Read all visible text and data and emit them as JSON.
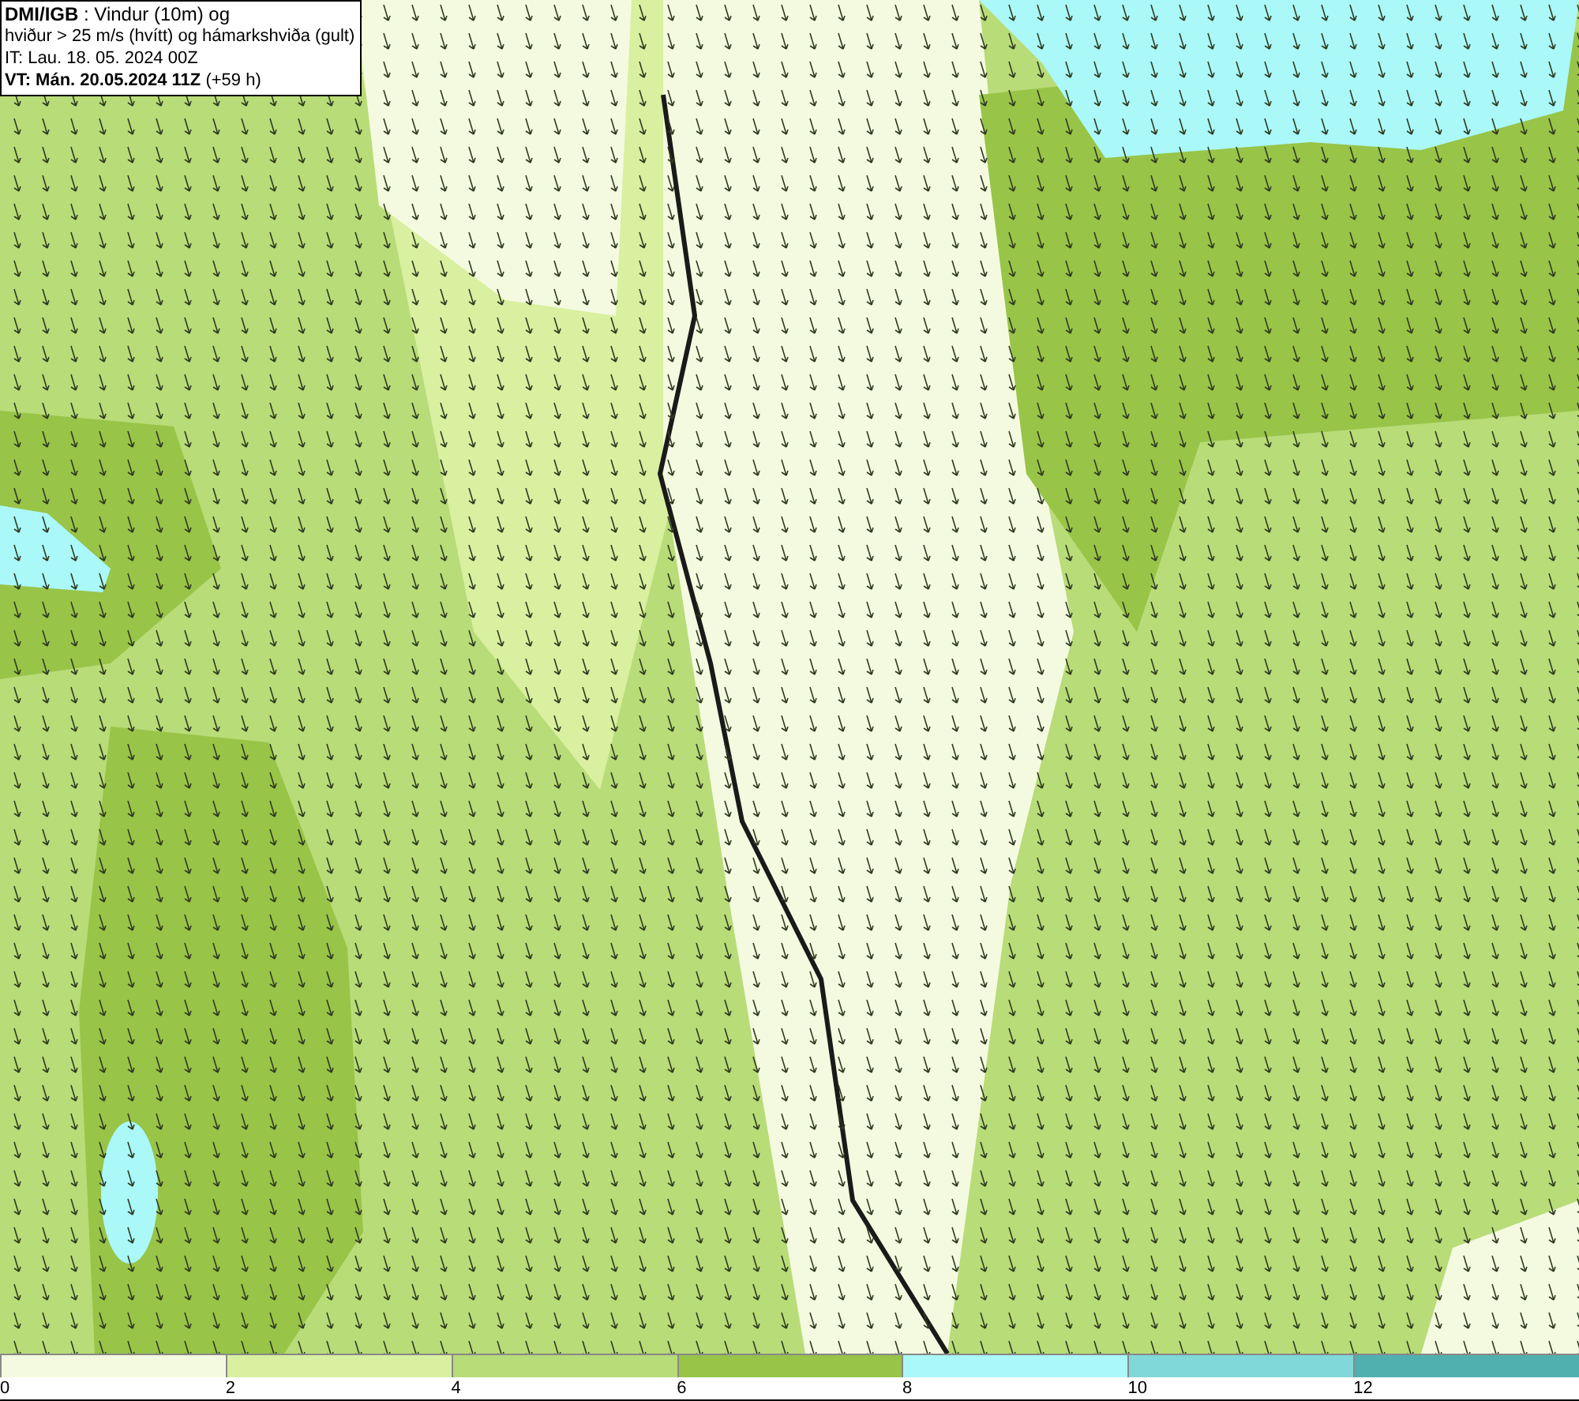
{
  "title_box": {
    "lines": [
      "**DMI/IGB** : Vindur (10m) og",
      "hviður > 25 m/s (hvítt) og hámarkshviða (gult)",
      "IT: Lau. 18. 05. 2024 00Z",
      "**VT: Mán. 20.05.2024 11Z** (+59 h)"
    ]
  },
  "legend": {
    "bins": [
      {
        "label": "0",
        "color": "#f4fae0"
      },
      {
        "label": "2",
        "color": "#d8f0a0"
      },
      {
        "label": "4",
        "color": "#b8dc78"
      },
      {
        "label": "6",
        "color": "#98c448"
      },
      {
        "label": "8",
        "color": "#aaf8f8"
      },
      {
        "label": "10",
        "color": "#80d8d8"
      },
      {
        "label": "12",
        "color": "#50b0b0"
      }
    ]
  }
}
